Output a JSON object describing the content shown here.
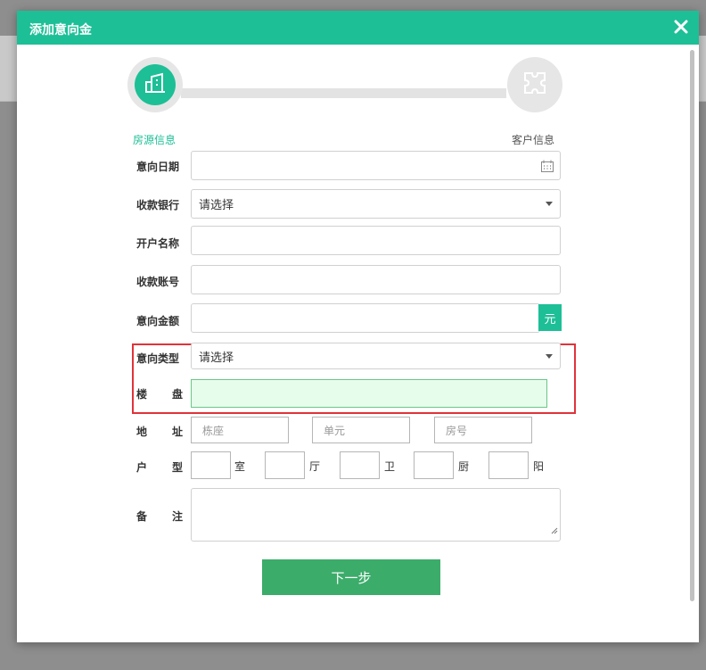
{
  "modal": {
    "title": "添加意向金",
    "close_icon": "close-icon"
  },
  "steps": [
    {
      "label": "房源信息",
      "icon": "building-icon",
      "active": true
    },
    {
      "label": "客户信息",
      "icon": "puzzle-icon",
      "active": false
    }
  ],
  "form": {
    "intent_date": {
      "label": "意向日期",
      "value": ""
    },
    "bank": {
      "label": "收款银行",
      "value": "请选择"
    },
    "account_name": {
      "label": "开户名称",
      "value": ""
    },
    "account_no": {
      "label": "收款账号",
      "value": ""
    },
    "amount": {
      "label": "意向金额",
      "value": "",
      "unit": "元"
    },
    "intent_type": {
      "label": "意向类型",
      "value": "请选择"
    },
    "estate": {
      "label_a": "楼",
      "label_b": "盘",
      "value": ""
    },
    "address": {
      "label_a": "地",
      "label_b": "址",
      "building_placeholder": "栋座",
      "unit_placeholder": "单元",
      "room_placeholder": "房号"
    },
    "layout": {
      "label_a": "户",
      "label_b": "型",
      "units": [
        "室",
        "厅",
        "卫",
        "厨",
        "阳"
      ]
    },
    "remark": {
      "label_a": "备",
      "label_b": "注",
      "value": ""
    }
  },
  "next_button": "下一步",
  "colors": {
    "primary": "#1dbf96",
    "button": "#3cac6a",
    "highlight": "#e0333a"
  }
}
